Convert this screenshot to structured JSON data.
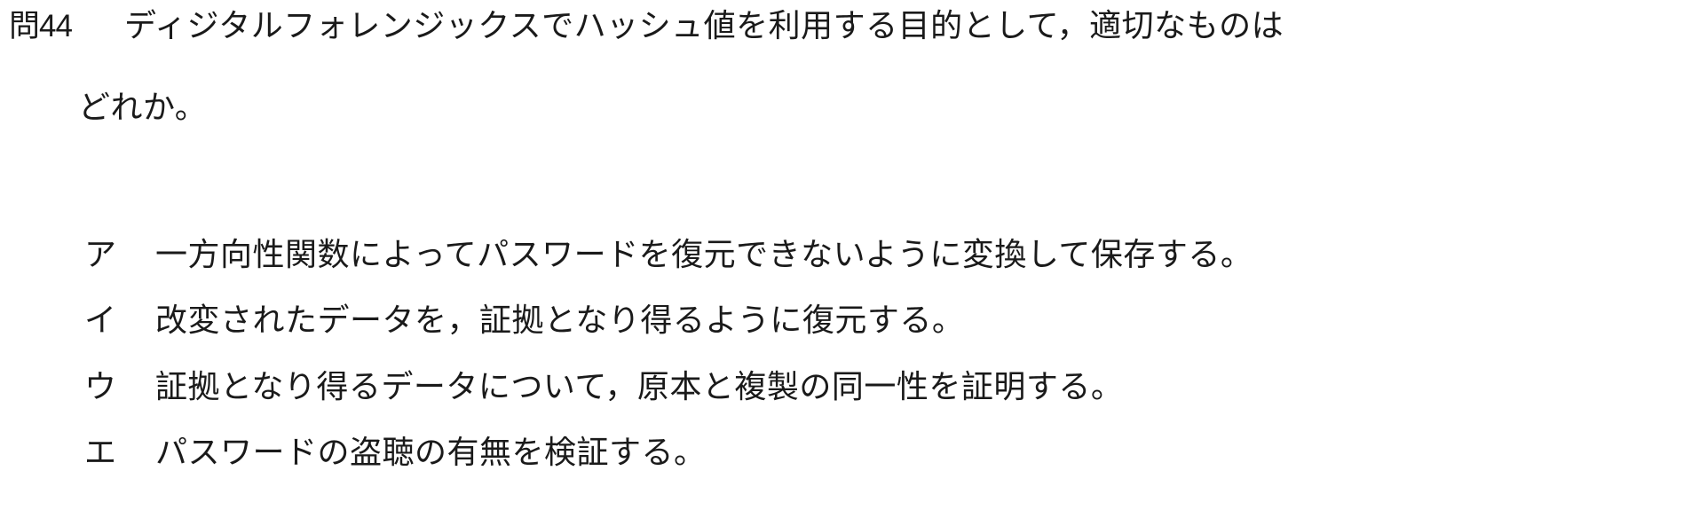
{
  "question": {
    "number": "問44",
    "text_line1": "ディジタルフォレンジックスでハッシュ値を利用する目的として，適切なものは",
    "text_line2": "どれか。"
  },
  "choices": [
    {
      "label": "ア",
      "text": "一方向性関数によってパスワードを復元できないように変換して保存する。"
    },
    {
      "label": "イ",
      "text": "改変されたデータを，証拠となり得るように復元する。"
    },
    {
      "label": "ウ",
      "text": "証拠となり得るデータについて，原本と複製の同一性を証明する。"
    },
    {
      "label": "エ",
      "text": "パスワードの盗聴の有無を検証する。"
    }
  ]
}
